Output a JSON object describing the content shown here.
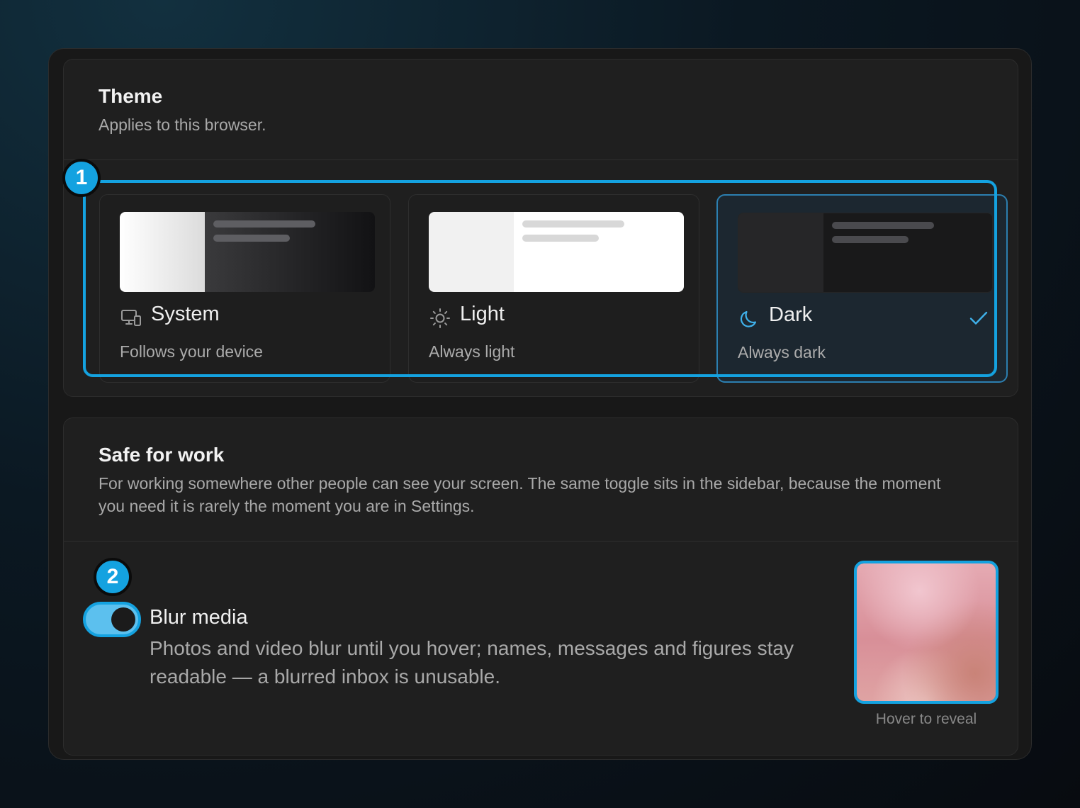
{
  "theme": {
    "title": "Theme",
    "subtitle": "Applies to this browser.",
    "options": [
      {
        "label": "System",
        "description": "Follows your device",
        "icon": "monitor-icon",
        "selected": false
      },
      {
        "label": "Light",
        "description": "Always light",
        "icon": "sun-icon",
        "selected": false
      },
      {
        "label": "Dark",
        "description": "Always dark",
        "icon": "moon-icon",
        "selected": true
      }
    ]
  },
  "safe_for_work": {
    "title": "Safe for work",
    "subtitle": "For working somewhere other people can see your screen. The same toggle sits in the sidebar, because the moment you need it is rarely the moment you are in Settings.",
    "blur_media": {
      "label": "Blur media",
      "description": "Photos and video blur until you hover; names, messages and figures stay readable — a blurred inbox is unusable.",
      "enabled": true,
      "preview_caption": "Hover to reveal"
    }
  },
  "badges": [
    "1",
    "2"
  ],
  "colors": {
    "accent": "#14a2e0",
    "card_bg": "#1f1f1f",
    "selected_bg": "#1c2730"
  }
}
